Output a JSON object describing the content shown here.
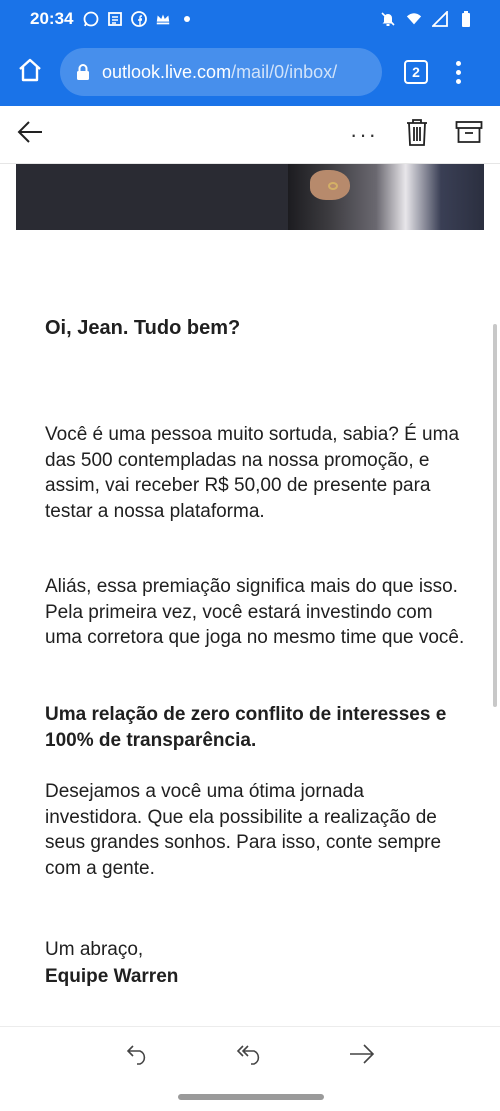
{
  "status_bar": {
    "time": "20:34",
    "left_icons": [
      "whatsapp-icon",
      "news-icon",
      "facebook-icon",
      "crown-icon",
      "dot-icon"
    ],
    "right_icons": [
      "mute-icon",
      "wifi-icon",
      "signal-icon",
      "battery-icon"
    ]
  },
  "browser": {
    "url_host": "outlook.live.com",
    "url_path": "/mail/0/inbox/",
    "tab_count": "2"
  },
  "toolbar": {
    "more_label": "···"
  },
  "email": {
    "greeting": "Oi, Jean. Tudo bem?",
    "paragraph_1": "Você é uma pessoa muito sortuda, sabia? É uma das 500 contempladas na nossa promoção, e assim, vai receber R$ 50,00 de presente para testar a nossa plataforma.",
    "paragraph_2": "Aliás, essa premiação significa mais do que isso. Pela primeira vez, você estará investindo com uma corretora que joga no mesmo time que você.",
    "paragraph_3": "Uma relação de zero conflito de interesses e 100% de transparência.",
    "paragraph_4": "Desejamos a você uma ótima jornada investidora. Que ela possibilite a realização de seus grandes sonhos. Para isso, conte sempre com a gente.",
    "sign_off": "Um abraço,",
    "signature": "Equipe Warren"
  },
  "colors": {
    "chrome_blue": "#1a73e8",
    "text": "#202020",
    "hero_dark": "#2a2b33"
  }
}
